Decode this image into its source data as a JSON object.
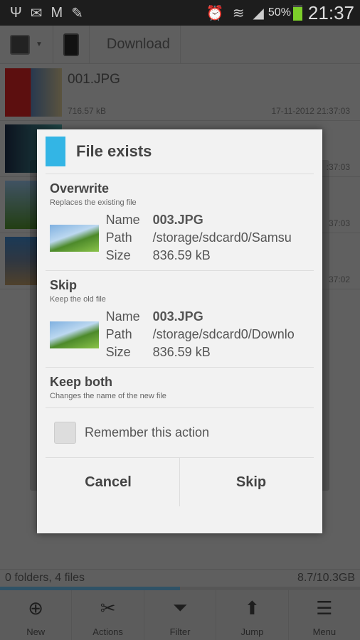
{
  "status": {
    "icons": [
      "usb-icon",
      "email-icon",
      "gmail-icon",
      "pencil-icon",
      "alarm-icon",
      "wifi-icon",
      "signal-icon"
    ],
    "battery": "50%",
    "time": "21:37"
  },
  "breadcrumb": {
    "items": [
      "device-icon",
      "tablet-icon",
      "Download"
    ]
  },
  "files": [
    {
      "name": "001.JPG",
      "size": "716.57 kB",
      "date": "17-11-2012 21:37:03"
    },
    {
      "name": "",
      "size": "",
      "date": ":37:03"
    },
    {
      "name": "",
      "size": "",
      "date": "37:03"
    },
    {
      "name": "",
      "size": "",
      "date": "37:02"
    }
  ],
  "footer": {
    "summary": "0 folders, 4 files",
    "storage": "8.7/10.3GB",
    "progress": 0.5
  },
  "toolbar": [
    {
      "label": "New",
      "icon": "⊕"
    },
    {
      "label": "Actions",
      "icon": "✂"
    },
    {
      "label": "Filter",
      "icon": "⏷"
    },
    {
      "label": "Jump",
      "icon": "⬆"
    },
    {
      "label": "Menu",
      "icon": "☰"
    }
  ],
  "dialog": {
    "title": "File exists",
    "accent": "#33b5e5",
    "overwrite": {
      "title": "Overwrite",
      "desc": "Replaces the existing file",
      "name_label": "Name",
      "name": "003.JPG",
      "path_label": "Path",
      "path": "/storage/sdcard0/Samsu",
      "size_label": "Size",
      "size": "836.59 kB"
    },
    "skip": {
      "title": "Skip",
      "desc": "Keep the old file",
      "name_label": "Name",
      "name": "003.JPG",
      "path_label": "Path",
      "path": "/storage/sdcard0/Downlo",
      "size_label": "Size",
      "size": "836.59 kB"
    },
    "keep": {
      "title": "Keep both",
      "desc": "Changes the name of the new file"
    },
    "remember": "Remember this action",
    "cancel": "Cancel",
    "skip_button": "Skip"
  }
}
